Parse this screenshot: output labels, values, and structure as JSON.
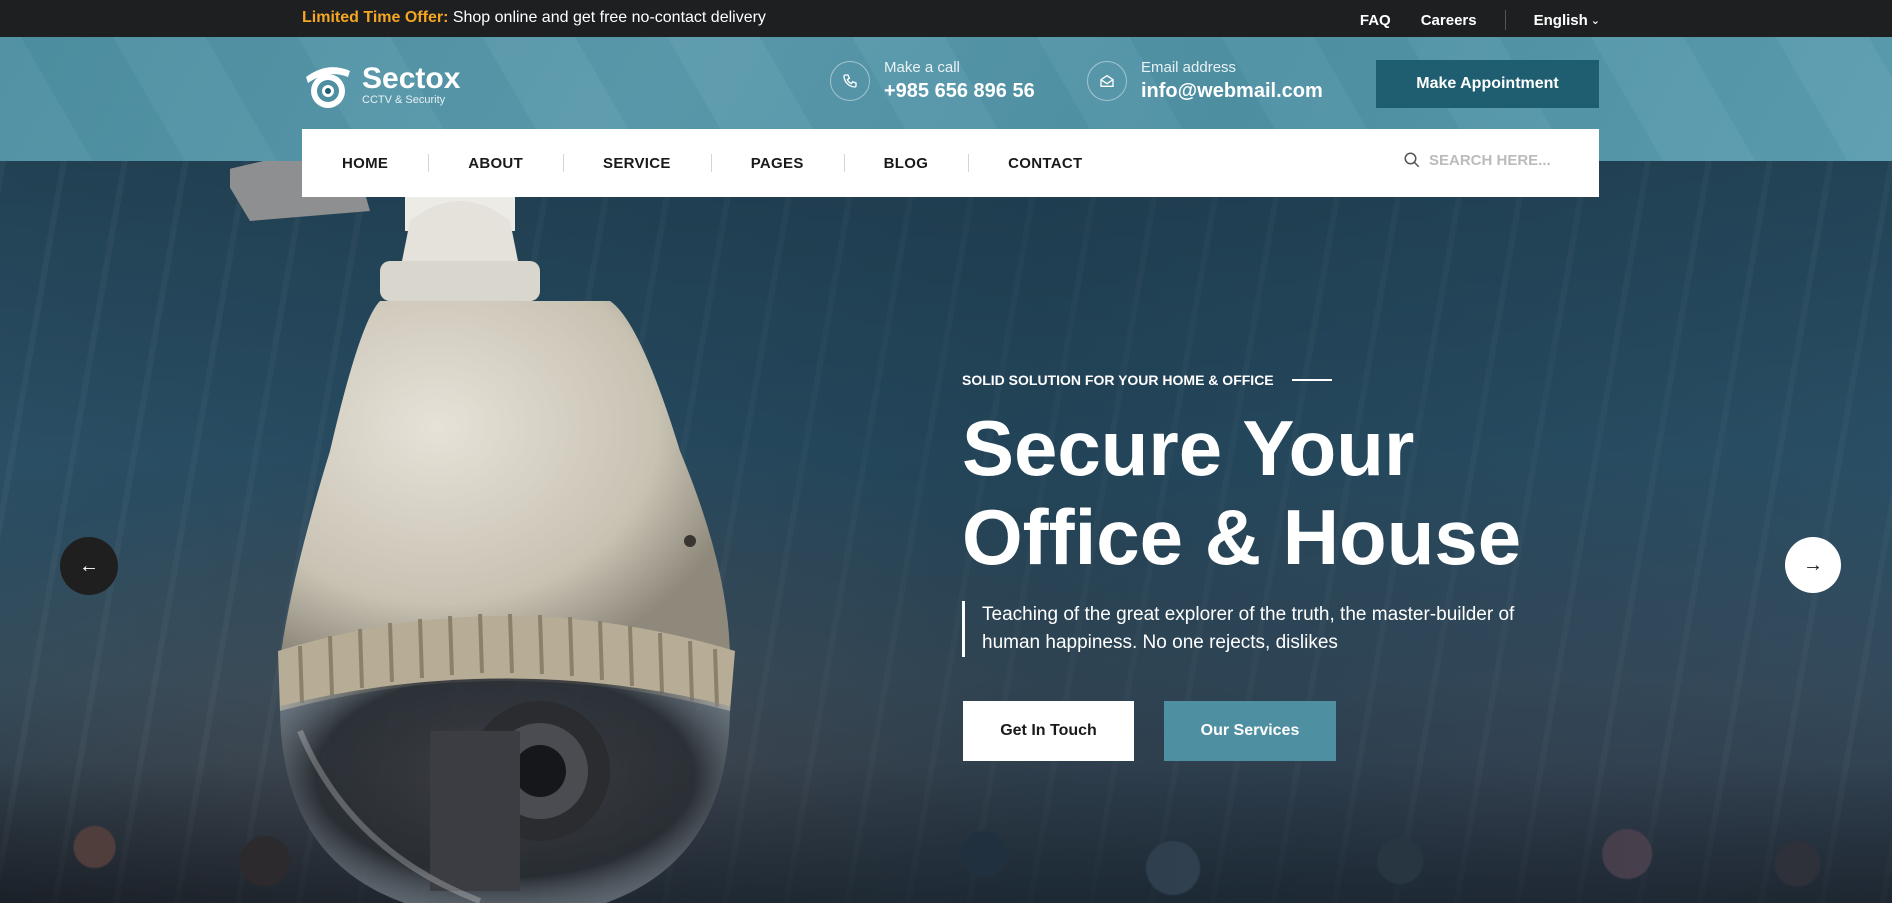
{
  "topbar": {
    "offer_highlight": "Limited Time Offer:",
    "offer_text": " Shop online and get free no-contact delivery",
    "links": {
      "faq": "FAQ",
      "careers": "Careers",
      "language": "English"
    }
  },
  "brand": {
    "name": "Sectox",
    "tagline": "CCTV & Security"
  },
  "contacts": {
    "call": {
      "label": "Make a call",
      "value": "+985 656 896 56",
      "icon": "phone-icon"
    },
    "email": {
      "label": "Email address",
      "value": "info@webmail.com",
      "icon": "envelope-icon"
    }
  },
  "header": {
    "appointment_label": "Make Appointment"
  },
  "nav": {
    "items": [
      "HOME",
      "ABOUT",
      "SERVICE",
      "PAGES",
      "BLOG",
      "CONTACT"
    ],
    "search_placeholder": "SEARCH HERE..."
  },
  "hero": {
    "eyebrow": "SOLID SOLUTION FOR YOUR HOME & OFFICE",
    "headline_line1": "Secure Your",
    "headline_line2": "Office & House",
    "description": "Teaching of the great explorer of the truth, the master-builder of human happiness. No one rejects, dislikes",
    "cta_primary": "Get In Touch",
    "cta_secondary": "Our Services",
    "prev_icon": "arrow-left-icon",
    "next_icon": "arrow-right-icon"
  },
  "colors": {
    "accent": "#4f8fa2",
    "dark_accent": "#1f5d70",
    "offer_highlight": "#f5a623",
    "topbar": "#1d1f21"
  }
}
